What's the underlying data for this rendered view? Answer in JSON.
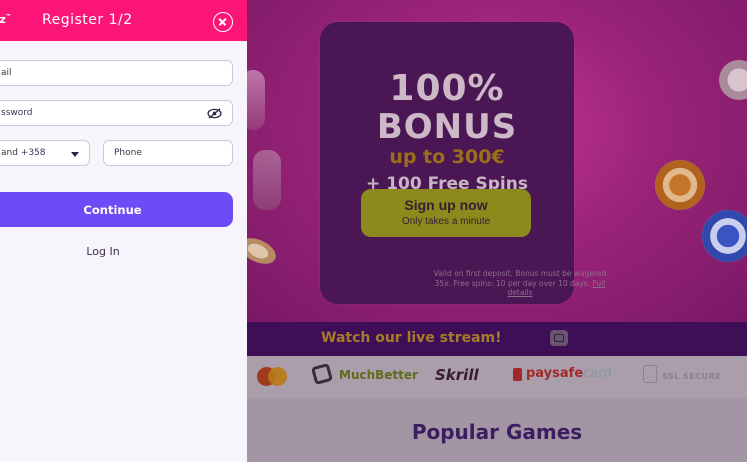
{
  "panel": {
    "brand": "nz",
    "brand_mark": "™",
    "title": "Register 1/2",
    "email_placeholder": "ail",
    "password_placeholder": "ssword",
    "country_value": "and +358",
    "phone_placeholder": "Phone",
    "continue_label": "Continue",
    "login_label": "Log In"
  },
  "promo": {
    "line1": "100%",
    "line2": "BONUS",
    "line3": "up to 300€",
    "line4": "+ 100 Free Spins",
    "signup_label": "Sign up now",
    "signup_sub": "Only takes a minute",
    "terms": "Valid on first deposit. Bonus must be wagered 35x. Free spins: 10 per day over 10 days.",
    "terms_link": "Full details"
  },
  "live": {
    "text": "Watch our live stream!"
  },
  "payments": {
    "muchbetter": "MuchBetter",
    "skrill": "Skrill",
    "paysafe": "paysafe",
    "paysafe_suffix": "card",
    "secure": "SSL SECURE"
  },
  "popular": {
    "title": "Popular Games"
  },
  "colors": {
    "header_pink": "#fa1576",
    "continue_purple": "#6d4cf7",
    "panel_bg": "#f7f4fc"
  }
}
